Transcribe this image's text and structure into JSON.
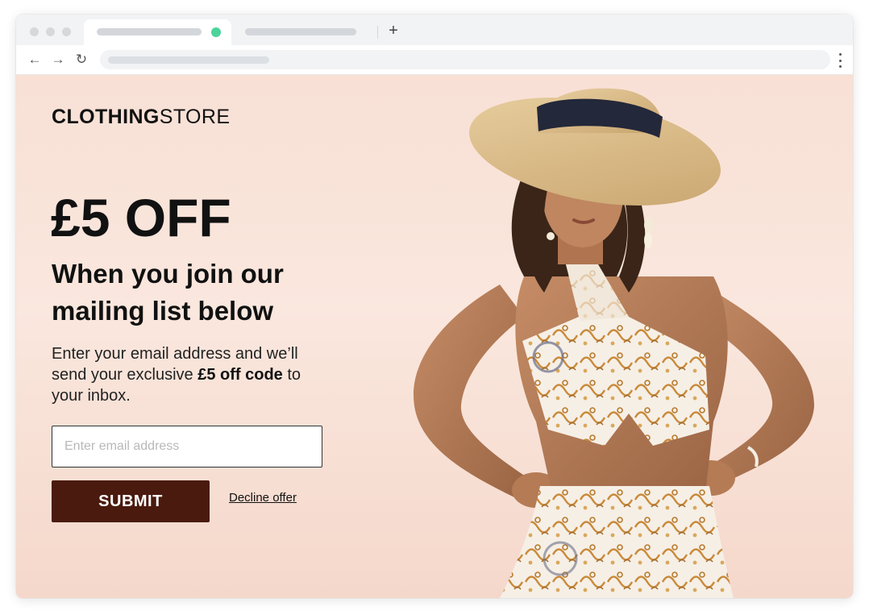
{
  "browser": {
    "tab_indicator_color": "#4cd49a",
    "new_tab_glyph": "+",
    "back_glyph": "←",
    "forward_glyph": "→",
    "reload_glyph": "↻",
    "icons": [
      "back-arrow-icon",
      "forward-arrow-icon",
      "reload-icon",
      "kebab-menu-icon",
      "new-tab-icon"
    ]
  },
  "page": {
    "logo_bold": "CLOTHING",
    "logo_regular": "STORE",
    "headline": "£5 OFF",
    "subheadline": "When you join our mailing list below",
    "body_before": "Enter your email address and we’ll send your exclusive ",
    "body_bold": "£5 off code",
    "body_after": " to your inbox.",
    "email_placeholder": "Enter email address",
    "email_value": "",
    "submit_label": "SUBMIT",
    "decline_label": "Decline offer",
    "colors": {
      "submit_bg": "#4a1a0e",
      "page_bg": "#f8e0d5",
      "text": "#111111"
    }
  }
}
